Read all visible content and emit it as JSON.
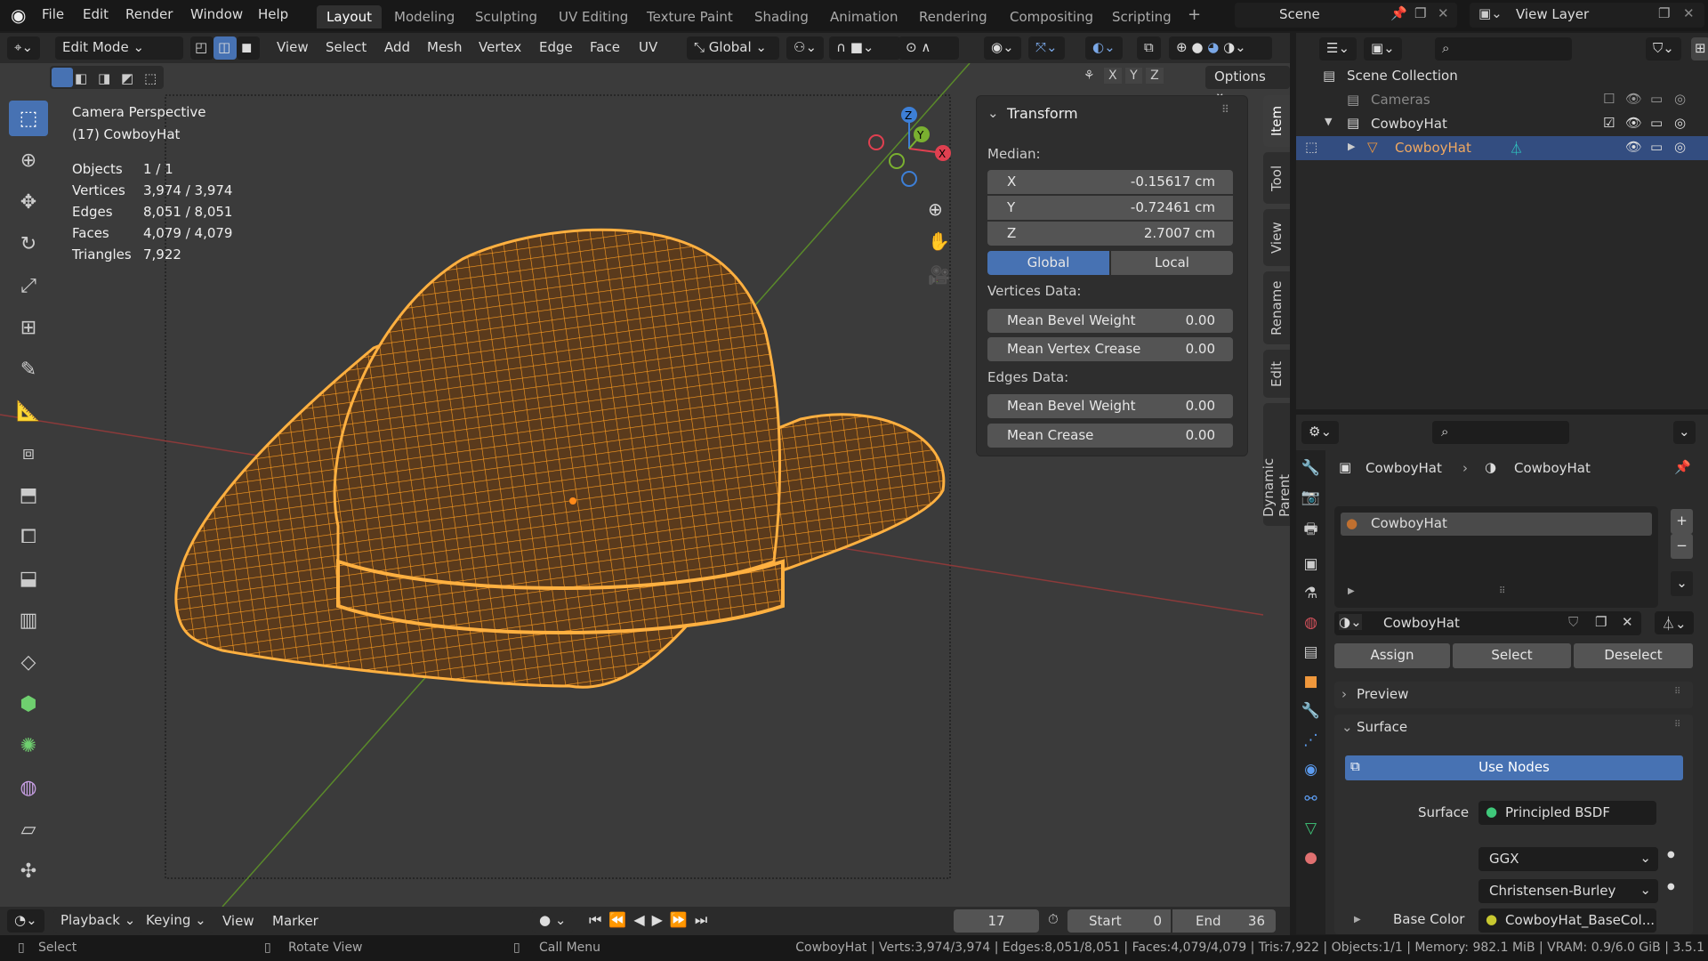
{
  "topbar": {
    "menus": [
      "File",
      "Edit",
      "Render",
      "Window",
      "Help"
    ],
    "workspaces": [
      "Layout",
      "Modeling",
      "Sculpting",
      "UV Editing",
      "Texture Paint",
      "Shading",
      "Animation",
      "Rendering",
      "Compositing",
      "Scripting"
    ],
    "active_workspace": "Layout",
    "scene": "Scene",
    "view_layer": "View Layer"
  },
  "header": {
    "mode": "Edit Mode",
    "menus": [
      "View",
      "Select",
      "Add",
      "Mesh",
      "Vertex",
      "Edge",
      "Face",
      "UV"
    ],
    "orientation": "Global",
    "axes": [
      "X",
      "Y",
      "Z"
    ],
    "options": "Options"
  },
  "viewport": {
    "title": "Camera Perspective",
    "object": "(17) CowboyHat",
    "stats": [
      {
        "label": "Objects",
        "value": "1 / 1"
      },
      {
        "label": "Vertices",
        "value": "3,974 / 3,974"
      },
      {
        "label": "Edges",
        "value": "8,051 / 8,051"
      },
      {
        "label": "Faces",
        "value": "4,079 / 4,079"
      },
      {
        "label": "Triangles",
        "value": "7,922"
      }
    ],
    "gizmo": {
      "x": "X",
      "y": "Y",
      "z": "Z"
    }
  },
  "npanel": {
    "title": "Transform",
    "median_label": "Median:",
    "median": [
      {
        "axis": "X",
        "value": "-0.15617 cm"
      },
      {
        "axis": "Y",
        "value": "-0.72461 cm"
      },
      {
        "axis": "Z",
        "value": "2.7007 cm"
      }
    ],
    "global": "Global",
    "local": "Local",
    "vertices_label": "Vertices Data:",
    "vertices": [
      {
        "label": "Mean Bevel Weight",
        "value": "0.00"
      },
      {
        "label": "Mean Vertex Crease",
        "value": "0.00"
      }
    ],
    "edges_label": "Edges Data:",
    "edges": [
      {
        "label": "Mean Bevel Weight",
        "value": "0.00"
      },
      {
        "label": "Mean Crease",
        "value": "0.00"
      }
    ],
    "tabs": [
      "Item",
      "Tool",
      "View",
      "Rename",
      "Edit",
      "Dynamic Parent"
    ]
  },
  "outliner": {
    "root": "Scene Collection",
    "items": [
      {
        "name": "Cameras"
      },
      {
        "name": "CowboyHat"
      },
      {
        "name": "CowboyHat"
      }
    ]
  },
  "properties": {
    "breadcrumb_object": "CowboyHat",
    "breadcrumb_material": "CowboyHat",
    "slot": "CowboyHat",
    "material_name": "CowboyHat",
    "assign": "Assign",
    "select": "Select",
    "deselect": "Deselect",
    "preview": "Preview",
    "surface_panel": "Surface",
    "use_nodes": "Use Nodes",
    "surface_label": "Surface",
    "surface_value": "Principled BSDF",
    "distribution": "GGX",
    "subsurface": "Christensen-Burley",
    "base_color_label": "Base Color",
    "base_color_value": "CowboyHat_BaseCol..."
  },
  "timeline": {
    "menus": [
      "Playback",
      "Keying",
      "View",
      "Marker"
    ],
    "current_frame": "17",
    "start_label": "Start",
    "start": "0",
    "end_label": "End",
    "end": "36"
  },
  "status": {
    "select": "Select",
    "rotate": "Rotate View",
    "call_menu": "Call Menu",
    "info": "CowboyHat | Verts:3,974/3,974 | Edges:8,051/8,051 | Faces:4,079/4,079 | Tris:7,922 | Objects:1/1 | Memory: 982.1 MiB | VRAM: 0.9/6.0 GiB | 3.5.1"
  },
  "colors": {
    "accent": "#4772b3",
    "wire": "#ff9d1f",
    "select_row": "#334d80"
  }
}
